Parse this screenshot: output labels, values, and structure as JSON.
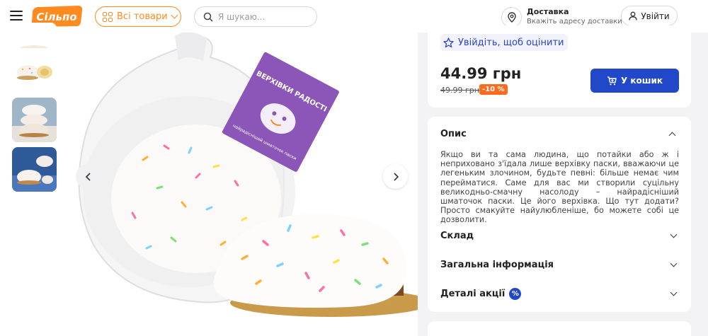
{
  "header": {
    "logo_text": "Сільпо",
    "catalog_label": "Всі товари",
    "search_placeholder": "Я шукаю...",
    "delivery_title": "Доставка",
    "delivery_subtitle": "Вкажіть адресу доставки",
    "login_label": "Увійти"
  },
  "product": {
    "package_text_1": "ВЕРХІВКИ РАДОСТІ",
    "package_text_2": "найрадісніший шматочок паски",
    "rate_label": "Увійдіть, щоб оцінити",
    "price": "44.99 грн",
    "old_price": "49.99 грн",
    "discount": "-10 %",
    "cart_label": "У кошик"
  },
  "description": {
    "title": "Опис",
    "text": "Якщо ви та сама людина, що потайки або ж і неприховано з'їдала лише верхівку паски, вважаючи це легеньким злочином, будьте певні: більше немає чим перейматися. Саме для вас ми створили суцільну великодньо-смачну насолоду – найрадісніший шматочок паски. Це його верхівка. Що тут додати? Просто смакуйте найулюбленіше, бо можете собі це дозволити."
  },
  "accordion": {
    "composition": "Склад",
    "general_info": "Загальна інформація",
    "promo_details": "Деталі акції",
    "promo_badge": "%"
  },
  "colors": {
    "brand_orange": "#ff8a1f",
    "primary_blue": "#2148c9",
    "discount_orange": "#ff6a1f"
  }
}
